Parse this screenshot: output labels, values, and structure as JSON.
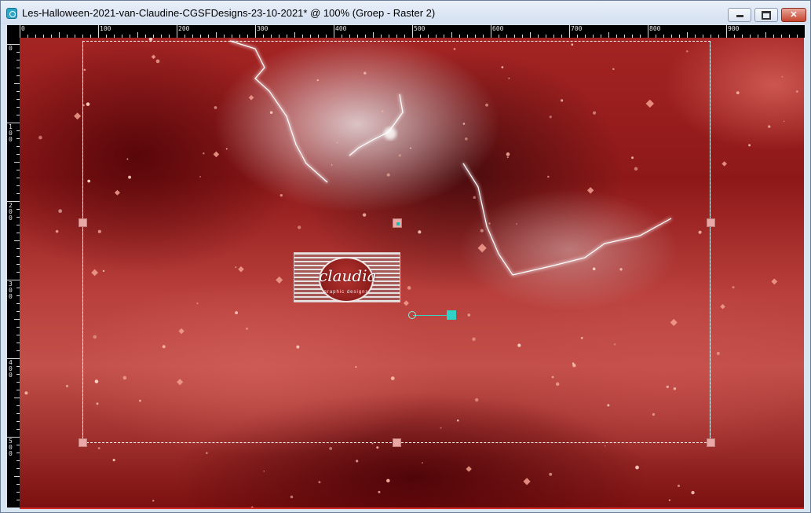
{
  "window": {
    "title": "Les-Halloween-2021-van-Claudine-CGSFDesigns-23-10-2021* @ 100% (Groep - Raster 2)",
    "app_icon": "psp-icon",
    "buttons": {
      "minimize": "minimize-icon",
      "maximize": "maximize-icon",
      "close": "✕"
    }
  },
  "ruler": {
    "top_labels": [
      "0",
      "100",
      "200",
      "300",
      "400",
      "500",
      "600",
      "700",
      "800",
      "900"
    ],
    "left_labels": [
      "0",
      "1\n0\n0",
      "2\n0\n0",
      "3\n0\n0",
      "4\n0\n0",
      "5\n0\n0"
    ]
  },
  "canvas": {
    "zoom": "100%",
    "layer_group": "Groep",
    "layer": "Raster 2",
    "colors": {
      "selection_border": "#ffffff",
      "handle_fill": "#e9a7a6",
      "pivot_color": "#32d1c5",
      "accent_red": "#d22a24"
    }
  },
  "watermark": {
    "name": "claudia",
    "tagline": "graphic designs"
  }
}
